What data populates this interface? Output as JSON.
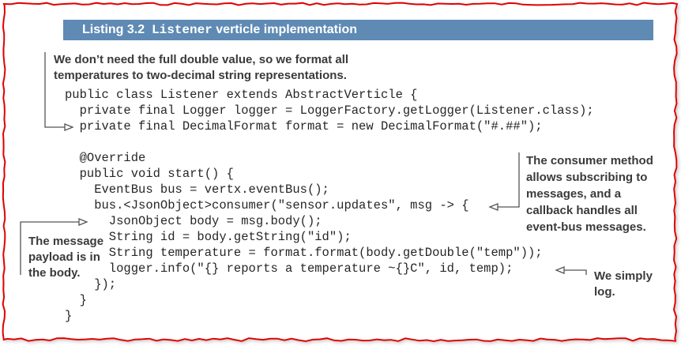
{
  "listing": {
    "number": "Listing 3.2",
    "code_word": "Listener",
    "title": "verticle implementation"
  },
  "annotations": {
    "format_note": [
      "We don’t need the full double value, so we format all",
      "temperatures to two-decimal string representations."
    ],
    "consumer_note": [
      "The consumer method",
      "allows subscribing to",
      "messages, and a",
      "callback handles all",
      "event-bus messages."
    ],
    "payload_note": [
      "The message",
      "payload is in",
      "the body."
    ],
    "log_note": [
      "We simply",
      "log."
    ]
  },
  "code_lines": [
    "public class Listener extends AbstractVerticle {",
    "  private final Logger logger = LoggerFactory.getLogger(Listener.class);",
    "  private final DecimalFormat format = new DecimalFormat(\"#.##\");",
    "",
    "  @Override",
    "  public void start() {",
    "    EventBus bus = vertx.eventBus();",
    "    bus.<JsonObject>consumer(\"sensor.updates\", msg -> {",
    "      JsonObject body = msg.body();",
    "      String id = body.getString(\"id\");",
    "      String temperature = format.format(body.getDouble(\"temp\"));",
    "      logger.info(\"{} reports a temperature ~{}C\", id, temp);",
    "    });",
    "  }",
    "}"
  ],
  "colors": {
    "banner_bg": "#5e8ab4",
    "banner_text": "#ffffff",
    "frame_border": "#e00000",
    "annotation_text": "#3a3a3a",
    "arrow": "#555555"
  }
}
